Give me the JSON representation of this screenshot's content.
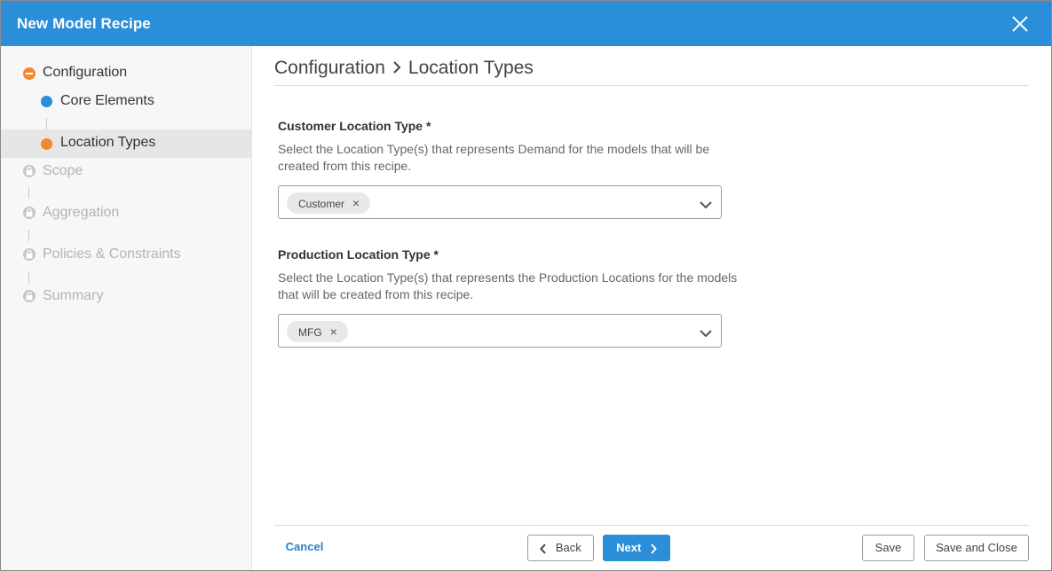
{
  "dialog": {
    "title": "New Model Recipe",
    "close_icon": "close-icon"
  },
  "sidebar": {
    "steps": [
      {
        "label": "Configuration",
        "state": "current-parent",
        "icon": "minus-circle-icon"
      },
      {
        "label": "Core Elements",
        "state": "completed-child",
        "icon": "dot-icon"
      },
      {
        "label": "Location Types",
        "state": "active-child",
        "icon": "dot-icon"
      },
      {
        "label": "Scope",
        "state": "locked",
        "icon": "lock-icon"
      },
      {
        "label": "Aggregation",
        "state": "locked",
        "icon": "lock-icon"
      },
      {
        "label": "Policies & Constraints",
        "state": "locked",
        "icon": "lock-icon"
      },
      {
        "label": "Summary",
        "state": "locked",
        "icon": "lock-icon"
      }
    ]
  },
  "breadcrumb": {
    "parent": "Configuration",
    "current": "Location Types"
  },
  "fields": {
    "customer": {
      "title": "Customer Location Type *",
      "description": "Select the Location Type(s) that represents Demand for the models that will be created from this recipe.",
      "chips": [
        "Customer"
      ]
    },
    "production": {
      "title": "Production Location Type *",
      "description": "Select the Location Type(s) that represents the Production Locations for the models that will be created from this recipe.",
      "chips": [
        "MFG"
      ]
    }
  },
  "footer": {
    "cancel_label": "Cancel",
    "back_label": "Back",
    "next_label": "Next",
    "save_label": "Save",
    "save_close_label": "Save and Close"
  },
  "colors": {
    "brand_blue": "#2b8ed8",
    "accent_orange": "#f08a2c",
    "locked_gray": "#c6c6c6"
  }
}
